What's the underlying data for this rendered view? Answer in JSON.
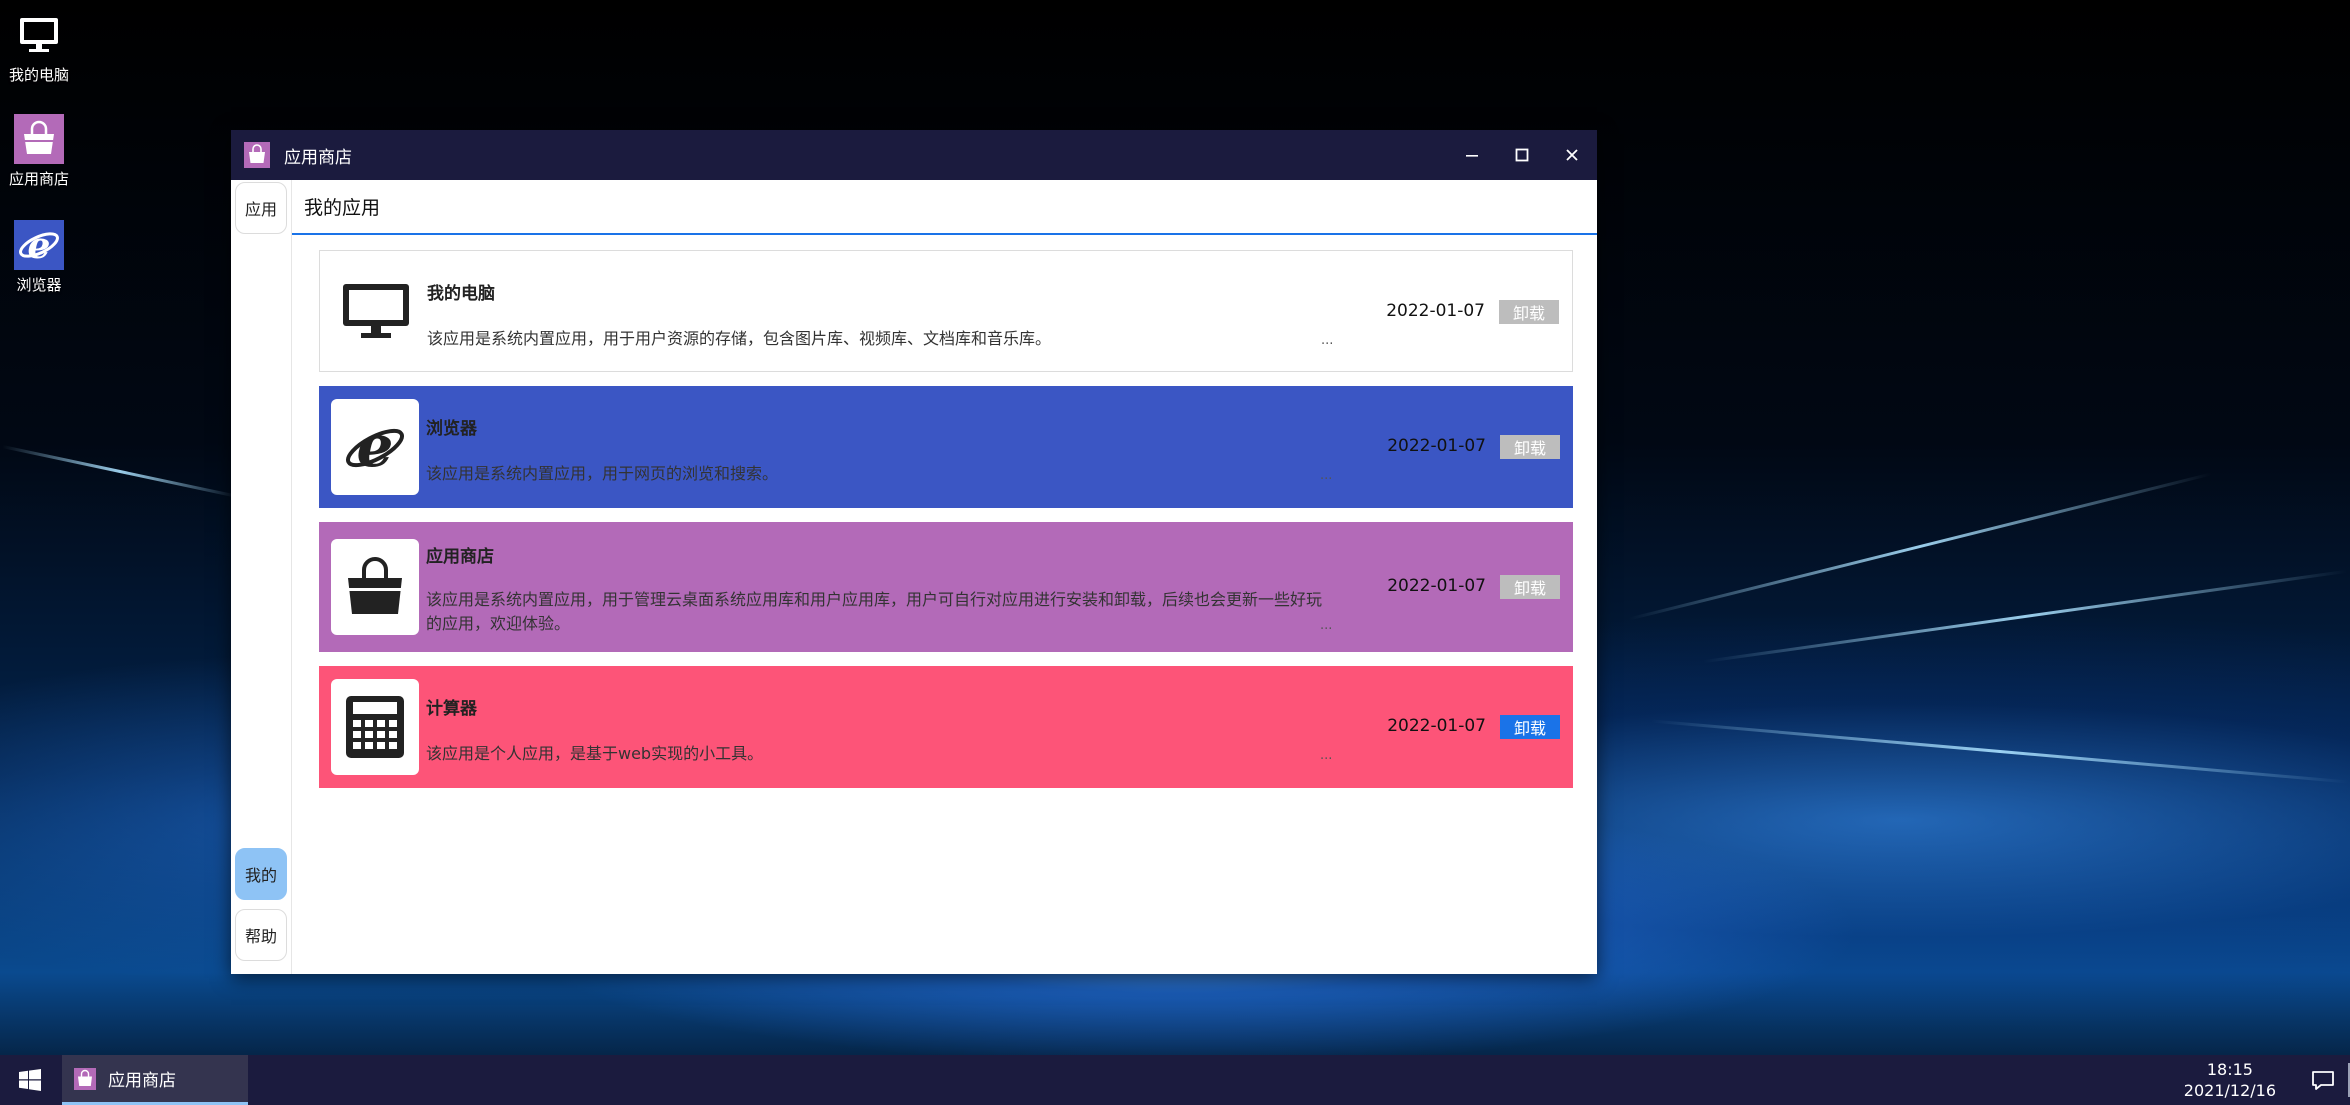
{
  "desktop": {
    "icons": [
      {
        "label": "我的电脑",
        "icon": "monitor-icon"
      },
      {
        "label": "应用商店",
        "icon": "shopping-bag-icon"
      },
      {
        "label": "浏览器",
        "icon": "ie-browser-icon"
      }
    ]
  },
  "window": {
    "title": "应用商店",
    "controls": {
      "minimize": "minimize-icon",
      "maximize": "maximize-icon",
      "close": "close-icon"
    },
    "sidenav": {
      "top": [
        {
          "label": "应用"
        }
      ],
      "bottom": [
        {
          "label": "我的",
          "active": true
        },
        {
          "label": "帮助"
        }
      ]
    },
    "tab": "我的应用",
    "apps": [
      {
        "name": "我的电脑",
        "description": "该应用是系统内置应用，用于用户资源的存储，包含图片库、视频库、文档库和音乐库。",
        "more": "...",
        "date": "2022-01-07",
        "action": "卸载",
        "action_enabled": false,
        "bg": "#ffffff",
        "icon": "monitor-icon"
      },
      {
        "name": "浏览器",
        "description": "该应用是系统内置应用，用于网页的浏览和搜索。",
        "more": "...",
        "date": "2022-01-07",
        "action": "卸载",
        "action_enabled": false,
        "bg": "#3b56c4",
        "icon": "ie-browser-icon"
      },
      {
        "name": "应用商店",
        "description": "该应用是系统内置应用，用于管理云桌面系统应用库和用户应用库，用户可自行对应用进行安装和卸载，后续也会更新一些好玩的应用，欢迎体验。",
        "more": "...",
        "date": "2022-01-07",
        "action": "卸载",
        "action_enabled": false,
        "bg": "#b36ab8",
        "icon": "shopping-bag-icon"
      },
      {
        "name": "计算器",
        "description": "该应用是个人应用，是基于web实现的小工具。",
        "more": "...",
        "date": "2022-01-07",
        "action": "卸载",
        "action_enabled": true,
        "bg": "#fd5478",
        "icon": "calculator-icon"
      }
    ]
  },
  "taskbar": {
    "start_icon": "windows-logo-icon",
    "items": [
      {
        "label": "应用商店",
        "icon": "shopping-bag-icon",
        "active": true
      }
    ],
    "clock": {
      "time": "18:15",
      "date": "2021/12/16"
    },
    "notification_icon": "chat-bubble-icon"
  },
  "colors": {
    "titlebar": "#1b1b3e",
    "accent": "#1a73e8",
    "nav_active": "#8ec3f5",
    "disabled_button": "#bdbdbd"
  }
}
